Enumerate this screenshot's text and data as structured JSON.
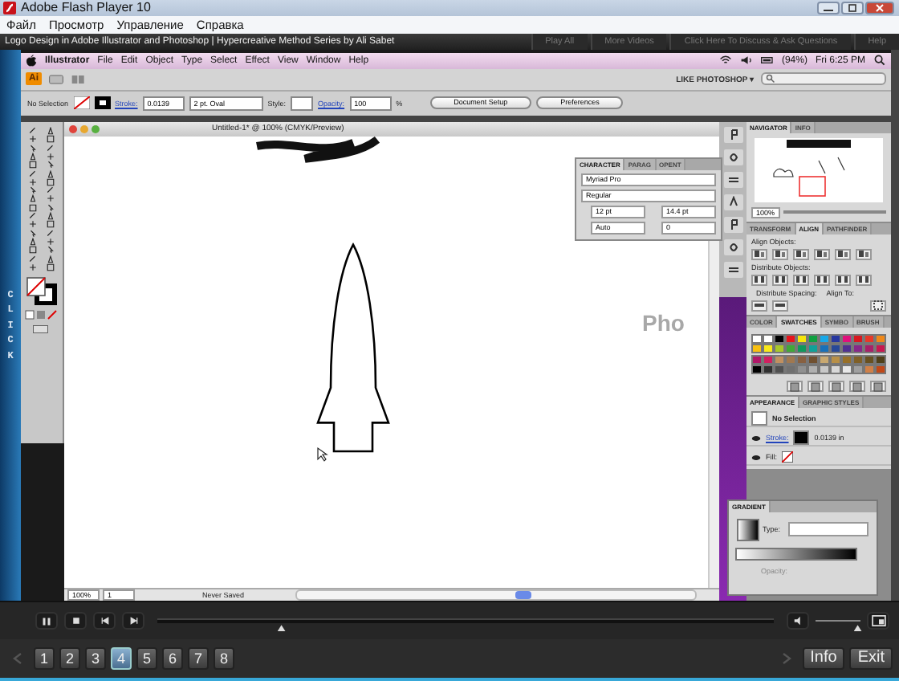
{
  "window": {
    "title": "Adobe Flash Player 10"
  },
  "menu": [
    "Файл",
    "Просмотр",
    "Управление",
    "Справка"
  ],
  "player_header": {
    "title": "Logo Design in Adobe Illustrator and Photoshop | Hypercreative Method Series by Ali Sabet",
    "buttons": [
      "Play All",
      "More Videos",
      "Click Here To Discuss & Ask Questions",
      "Help"
    ]
  },
  "side_tab": "CLICK",
  "mac_menu": {
    "app": "Illustrator",
    "items": [
      "File",
      "Edit",
      "Object",
      "Type",
      "Select",
      "Effect",
      "View",
      "Window",
      "Help"
    ],
    "battery": "(94%)",
    "clock": "Fri 6:25 PM"
  },
  "app_bar": {
    "logo": "Ai",
    "workspace": "LIKE PHOTOSHOP ▾"
  },
  "control_panel": {
    "selection": "No Selection",
    "stroke_label": "Stroke:",
    "stroke": "0.0139",
    "brush": "2 pt. Oval",
    "style_label": "Style:",
    "opacity_label": "Opacity:",
    "opacity": "100",
    "percent": "%",
    "buttons": [
      "Document Setup",
      "Preferences"
    ]
  },
  "document": {
    "title": "Untitled-1* @ 100% (CMYK/Preview)",
    "zoom": "100%",
    "artboard": "1",
    "status": "Never Saved",
    "background_text": "Pho"
  },
  "character_panel": {
    "tabs": [
      {
        "label": "CHARACTER",
        "selected": true
      },
      {
        "label": "PARAG",
        "selected": false
      },
      {
        "label": "OPENT",
        "selected": false
      }
    ],
    "font": "Myriad Pro",
    "style": "Regular",
    "size": "12 pt",
    "leading": "14.4 pt",
    "kerning": "Auto",
    "tracking": "0"
  },
  "navigator": {
    "tabs": [
      {
        "label": "NAVIGATOR",
        "selected": true
      },
      {
        "label": "INFO",
        "selected": false
      }
    ],
    "zoom": "100%"
  },
  "align_panel": {
    "tabs": [
      {
        "label": "TRANSFORM",
        "selected": false
      },
      {
        "label": "ALIGN",
        "selected": true
      },
      {
        "label": "PATHFINDER",
        "selected": false
      }
    ],
    "align_objects": "Align Objects:",
    "distribute_objects": "Distribute Objects:",
    "distribute_spacing": "Distribute Spacing:",
    "align_to": "Align To:"
  },
  "swatches_panel": {
    "tabs": [
      {
        "label": "COLOR",
        "selected": false
      },
      {
        "label": "SWATCHES",
        "selected": true
      },
      {
        "label": "SYMBO",
        "selected": false
      },
      {
        "label": "BRUSH",
        "selected": false
      }
    ],
    "swatches": [
      {
        "color": "#ffffff"
      },
      {
        "color": "#ffffff"
      },
      {
        "color": "#000000"
      },
      {
        "color": "#e8141c"
      },
      {
        "color": "#f5e50a"
      },
      {
        "color": "#10a040"
      },
      {
        "color": "#18a8e8"
      },
      {
        "color": "#2838a0"
      },
      {
        "color": "#e0107c"
      },
      {
        "color": "#d81820"
      },
      {
        "color": "#e83828"
      },
      {
        "color": "#f08818"
      },
      {
        "color": "#f8c010"
      },
      {
        "color": "#f8e818"
      },
      {
        "color": "#a8c828"
      },
      {
        "color": "#40a838"
      },
      {
        "color": "#10985c"
      },
      {
        "color": "#10a098"
      },
      {
        "color": "#1870b8"
      },
      {
        "color": "#284898"
      },
      {
        "color": "#503090"
      },
      {
        "color": "#882888"
      },
      {
        "color": "#a82068"
      },
      {
        "color": "#c81850"
      },
      {
        "color": "#b01868"
      },
      {
        "color": "#d02060"
      },
      {
        "color": "#c09060"
      },
      {
        "color": "#a07850"
      },
      {
        "color": "#886040"
      },
      {
        "color": "#705030"
      },
      {
        "color": "#c8a870"
      },
      {
        "color": "#b89048"
      },
      {
        "color": "#987028"
      },
      {
        "color": "#806028"
      },
      {
        "color": "#685020"
      },
      {
        "color": "#504018"
      },
      {
        "color": "#000000"
      },
      {
        "color": "#303030"
      },
      {
        "color": "#505050"
      },
      {
        "color": "#707070"
      },
      {
        "color": "#909090"
      },
      {
        "color": "#b0b0b0"
      },
      {
        "color": "#c8c8c8"
      },
      {
        "color": "#d8d8d8"
      },
      {
        "color": "#e8e8e8"
      },
      {
        "color": "#a0a0a0"
      },
      {
        "color": "#d08048"
      },
      {
        "color": "#c04818"
      }
    ]
  },
  "appearance_panel": {
    "tabs": [
      {
        "label": "APPEARANCE",
        "selected": true
      },
      {
        "label": "GRAPHIC STYLES",
        "selected": false
      }
    ],
    "title": "No Selection",
    "stroke_label": "Stroke:",
    "stroke_value": "0.0139 in",
    "fill_label": "Fill:"
  },
  "gradient_panel": {
    "tab": "GRADIENT",
    "type_label": "Type:",
    "opacity_label": "Opacity:"
  },
  "playback": {
    "seek": {
      "level": 0.2
    },
    "volume": {
      "level": 0.92
    }
  },
  "chapters": [
    {
      "label": "1",
      "selected": false
    },
    {
      "label": "2",
      "selected": false
    },
    {
      "label": "3",
      "selected": false
    },
    {
      "label": "4",
      "selected": true
    },
    {
      "label": "5",
      "selected": false
    },
    {
      "label": "6",
      "selected": false
    },
    {
      "label": "7",
      "selected": false
    },
    {
      "label": "8",
      "selected": false
    }
  ],
  "nav_buttons": [
    "Info",
    "Exit"
  ]
}
